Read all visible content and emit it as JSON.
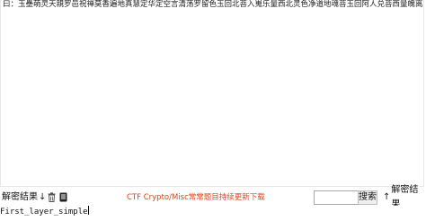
{
  "input": {
    "text": "曰：玉壘萌灵天親罗邑祝禅莫香遍地真慧定华定空言清荡罗留色玉回北菩入嵬乐量西北灵色净道地魂菩玉回阿人兑菩西量魄离界"
  },
  "toolbar": {
    "decode_label": "解密结果",
    "decode_arrow": "↓",
    "notice": "CTF Crypto/Misc常常题目持续更新下载",
    "search_placeholder": "",
    "search_value": "",
    "search_label": "搜索",
    "decode_up_arrow": "↑",
    "decode_up_label": "解密结果",
    "icons": {
      "trash": "trash-icon",
      "copy": "copy-icon"
    },
    "notice_color": "#e0431b"
  },
  "output": {
    "text": "First_layer_simple"
  }
}
